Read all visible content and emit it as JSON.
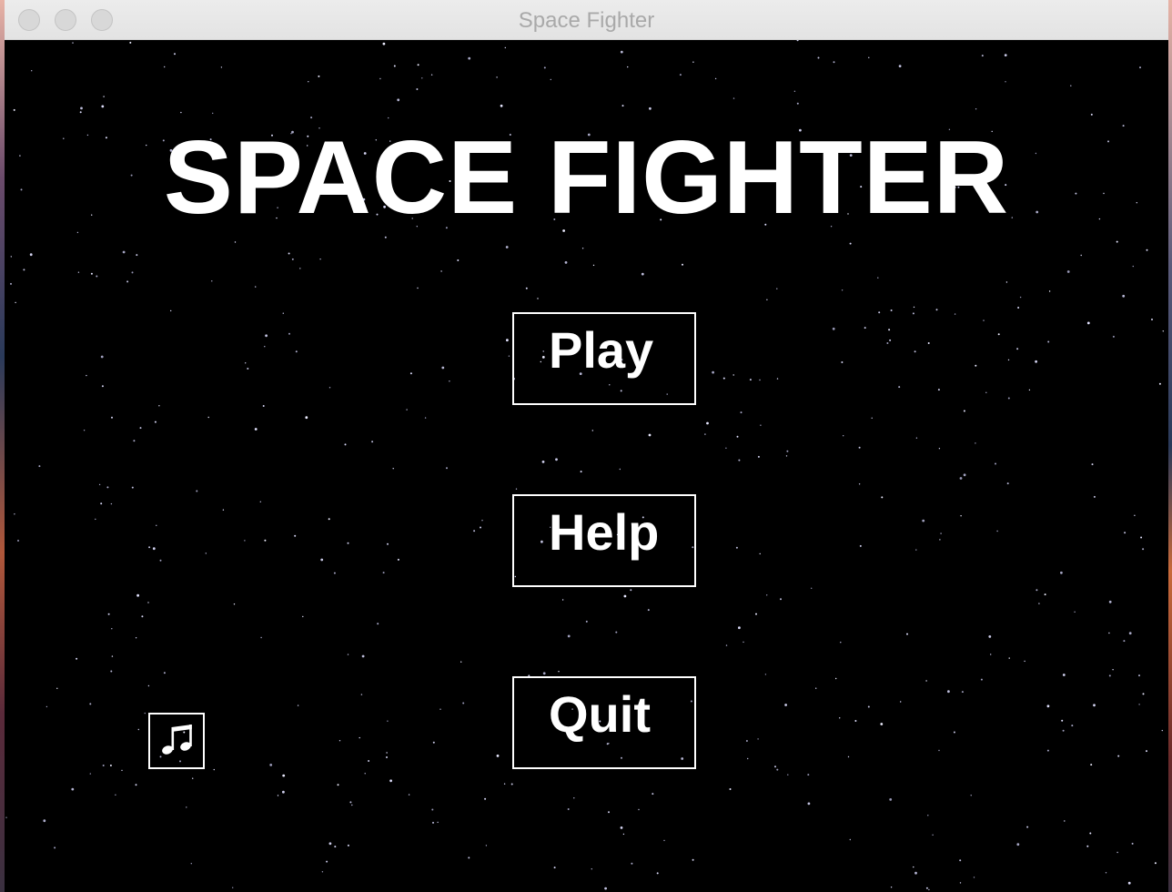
{
  "window": {
    "title": "Space Fighter"
  },
  "game": {
    "title": "SPACE FIGHTER",
    "menu": {
      "play_label": "Play",
      "help_label": "Help",
      "quit_label": "Quit"
    },
    "music_icon": "music-note-icon"
  },
  "colors": {
    "background": "#000000",
    "text": "#ffffff",
    "titlebar": "#e6e6e6",
    "title_text": "#a9a9a9"
  }
}
